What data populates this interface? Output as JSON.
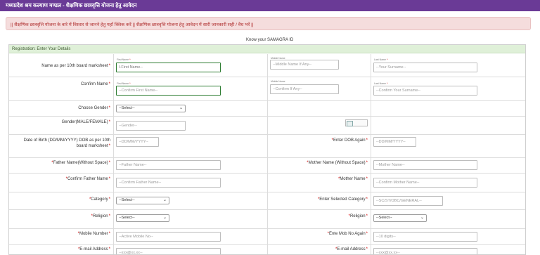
{
  "header": {
    "title": "मध्यप्रदेश श्रम कल्याण मण्डल - शैक्षणिक छात्रवृत्ति योजना हेतु आवेदन"
  },
  "notice": {
    "text": "|| शैक्षणिक छात्रवृत्ति योजना के बारे में विस्तार से जानने हेतु यहाँ क्लिक करें || शैक्षणिक छात्रवृत्ति योजना हेतु आवेदन में सारी जानकारी सही / वैध भरें ||"
  },
  "samagra": {
    "label": "Know your SAMAGRA ID"
  },
  "form": {
    "heading": "Registration: Enter Your Details",
    "name": {
      "label": "Name  as per 10th board marksheet",
      "first_caption": "First Name",
      "first_value": "I-First Name--",
      "middle_caption": "Middle Name",
      "middle_placeholder": "--Middle Name If Any--",
      "last_caption": "Last Name",
      "last_placeholder": "--Your Surname--"
    },
    "confirm_name": {
      "label": "Confirm Name",
      "first_caption": "First Name",
      "first_placeholder": "--Confirm First Name--",
      "middle_caption": "Middle Name",
      "middle_placeholder": "--Confirm If Any--",
      "last_caption": "Last Name",
      "last_placeholder": "--Confirm Your Surname--"
    },
    "gender_choose": {
      "label": "Choose Gender",
      "selected": "--Select--"
    },
    "gender_text": {
      "label": "Gender(MALE/FEMALE)",
      "placeholder": "--Gender--"
    },
    "dob": {
      "label": "Date of Birth (DD/MM/YYYY)   DOB as per 10th board marksheet",
      "placeholder": "--DD/MM/YYYY--",
      "again_label": "Enter DOB Again",
      "again_placeholder": "--DD/MM/YYYY--"
    },
    "father": {
      "label": "Father Name(Without Space)",
      "placeholder": "--Father Name--"
    },
    "mother": {
      "label": "Mother Name (Without Space)",
      "placeholder": "--Mother Name--"
    },
    "confirm_father": {
      "label": "Confirm Father Name",
      "placeholder": "--Confirm Father Name--"
    },
    "confirm_mother": {
      "label": "Mother Name",
      "placeholder": "--Confirm Mother Name--"
    },
    "category": {
      "label": "Category",
      "selected": "--Select--"
    },
    "selected_category": {
      "label": "Enter Selected Category",
      "placeholder": "--SC/ST/OBC/GENERAL--"
    },
    "religion": {
      "label": "Religion",
      "selected": "--Select--"
    },
    "religion2": {
      "label": "Religion",
      "selected": "--Select--"
    },
    "mobile": {
      "label": "Mobile Number",
      "placeholder": "--Active Mobile No--"
    },
    "mobile_again": {
      "label": "Ente Mob No Again",
      "placeholder": "--10 digits--"
    },
    "email": {
      "label": "E-mail Address",
      "placeholder": "--xxx@xx.xx--"
    },
    "email_again": {
      "label": "E-mail Address",
      "placeholder": "--xxx@xx.xx--"
    }
  },
  "colors": {
    "header_bg": "#6a3a96",
    "notice_bg": "#f5dddd",
    "notice_text": "#b03030",
    "form_head_bg": "#dff0d8",
    "required": "#d00000",
    "focus_border": "#2e7d32"
  }
}
